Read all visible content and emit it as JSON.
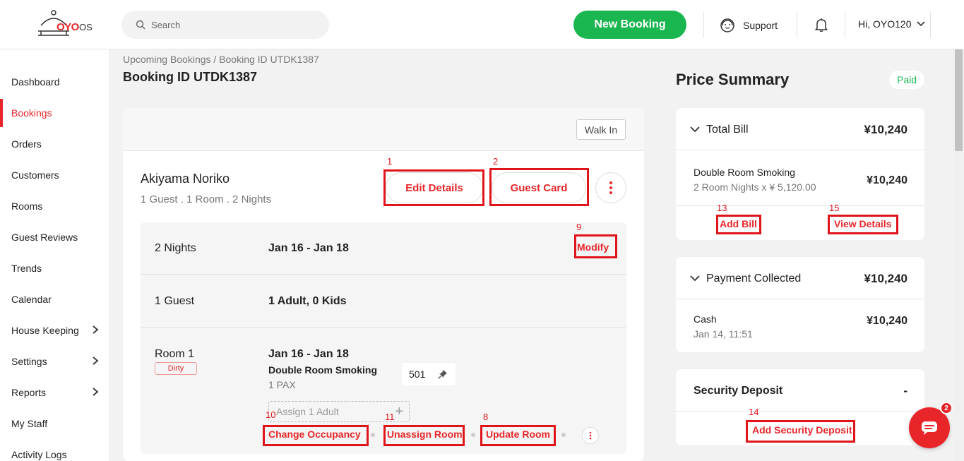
{
  "header": {
    "logo_text": "OYO",
    "logo_suffix": "OS",
    "search_placeholder": "Search",
    "new_booking_label": "New Booking",
    "support_label": "Support",
    "user_label": "Hi, OYO120"
  },
  "sidebar": {
    "items": [
      {
        "label": "Dashboard"
      },
      {
        "label": "Bookings",
        "active": true
      },
      {
        "label": "Orders"
      },
      {
        "label": "Customers"
      },
      {
        "label": "Rooms"
      },
      {
        "label": "Guest Reviews"
      },
      {
        "label": "Trends"
      },
      {
        "label": "Calendar"
      },
      {
        "label": "House Keeping",
        "expandable": true
      },
      {
        "label": "Settings",
        "expandable": true
      },
      {
        "label": "Reports",
        "expandable": true
      },
      {
        "label": "My Staff"
      },
      {
        "label": "Activity Logs"
      }
    ]
  },
  "main": {
    "breadcrumb": "Upcoming Bookings / Booking ID UTDK1387",
    "title": "Booking ID UTDK1387",
    "booking_type": "Walk In",
    "guest_name": "Akiyama Noriko",
    "guest_meta": "1 Guest . 1 Room . 2 Nights",
    "edit_details_label": "Edit Details",
    "guest_card_label": "Guest Card",
    "nights_label": "2 Nights",
    "date_range": "Jan 16 - Jan 18",
    "modify_label": "Modify",
    "guests_label": "1 Guest",
    "guests_value": "1 Adult, 0 Kids",
    "room": {
      "label": "Room 1",
      "status": "Dirty",
      "dates": "Jan 16 - Jan 18",
      "type": "Double Room Smoking",
      "pax": "1 PAX",
      "number": "501",
      "assign_placeholder": "Assign 1 Adult"
    },
    "actions": {
      "change_occupancy": "Change Occupancy",
      "unassign_room": "Unassign Room",
      "update_room": "Update Room"
    }
  },
  "annotations": [
    "1",
    "2",
    "9",
    "10",
    "11",
    "8",
    "13",
    "15",
    "14"
  ],
  "price_summary": {
    "title": "Price Summary",
    "status": "Paid",
    "total_bill": {
      "label": "Total Bill",
      "amount": "¥10,240",
      "item_name": "Double Room Smoking",
      "item_detail": "2 Room Nights x ¥ 5,120.00",
      "item_amount": "¥10,240",
      "add_bill": "Add Bill",
      "view_details": "View Details"
    },
    "payment": {
      "label": "Payment Collected",
      "amount": "¥10,240",
      "method": "Cash",
      "date": "Jan 14, 11:51",
      "method_amount": "¥10,240"
    },
    "security_deposit": {
      "label": "Security Deposit",
      "value": "-",
      "add_label": "Add Security Deposit"
    }
  },
  "chat": {
    "badge": "2"
  },
  "colors": {
    "brand": "#e8262a",
    "green": "#1ab64f",
    "annotation": "#e0141b"
  }
}
